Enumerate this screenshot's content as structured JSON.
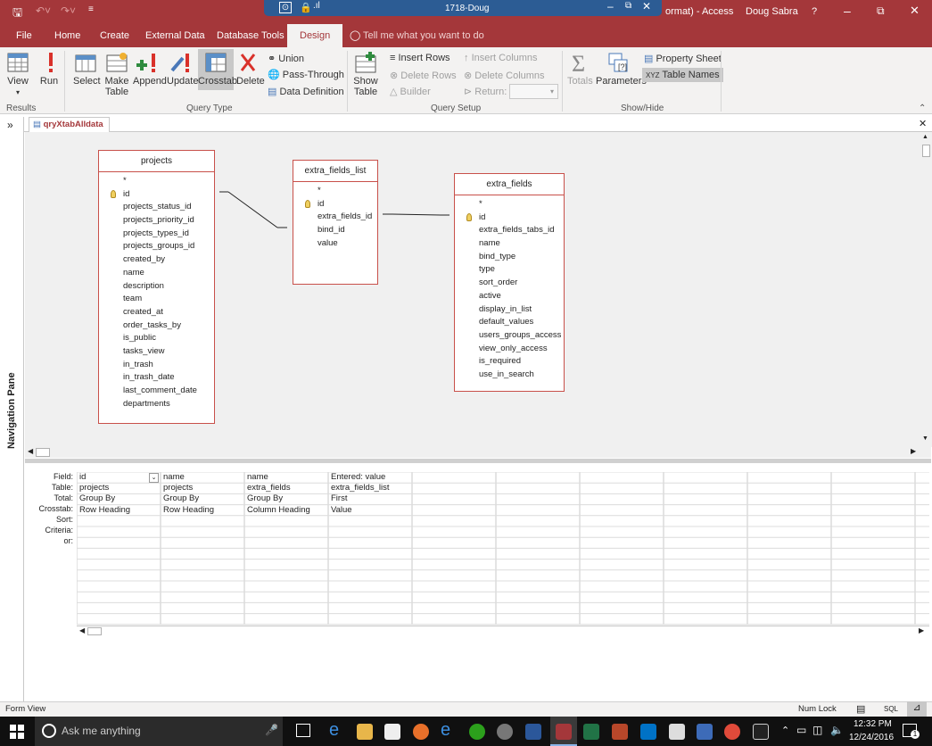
{
  "titlebar": {
    "remote_title": "1718-Doug",
    "app_title_fragment": "ormat) - Access",
    "user": "Doug Sabra",
    "help": "?",
    "quick_access": [
      "save",
      "undo",
      "redo",
      "customize"
    ]
  },
  "ribbon_tabs": [
    "File",
    "Home",
    "Create",
    "External Data",
    "Database Tools",
    "Design"
  ],
  "active_tab": "Design",
  "tell_me": "Tell me what you want to do",
  "ribbon": {
    "results": {
      "label": "Results",
      "view": "View",
      "run": "Run"
    },
    "query_type": {
      "label": "Query Type",
      "select": "Select",
      "make_table": "Make Table",
      "append": "Append",
      "update": "Update",
      "crosstab": "Crosstab",
      "delete": "Delete",
      "union": "Union",
      "pass_through": "Pass-Through",
      "data_definition": "Data Definition"
    },
    "query_setup": {
      "label": "Query Setup",
      "show_table": "Show Table",
      "insert_rows": "Insert Rows",
      "delete_rows": "Delete Rows",
      "builder": "Builder",
      "insert_columns": "Insert Columns",
      "delete_columns": "Delete Columns",
      "return": "Return:"
    },
    "show_hide": {
      "label": "Show/Hide",
      "totals": "Totals",
      "parameters": "Parameters",
      "property_sheet": "Property Sheet",
      "table_names": "Table Names"
    }
  },
  "nav_pane": {
    "label": "Navigation Pane",
    "toggle": "»"
  },
  "document_tab": "qryXtabAlldata",
  "tables": {
    "projects": {
      "name": "projects",
      "fields": [
        "*",
        "id",
        "projects_status_id",
        "projects_priority_id",
        "projects_types_id",
        "projects_groups_id",
        "created_by",
        "name",
        "description",
        "team",
        "created_at",
        "order_tasks_by",
        "is_public",
        "tasks_view",
        "in_trash",
        "in_trash_date",
        "last_comment_date",
        "departments"
      ]
    },
    "extra_fields_list": {
      "name": "extra_fields_list",
      "fields": [
        "*",
        "id",
        "extra_fields_id",
        "bind_id",
        "value"
      ]
    },
    "extra_fields": {
      "name": "extra_fields",
      "fields": [
        "*",
        "id",
        "extra_fields_tabs_id",
        "name",
        "bind_type",
        "type",
        "sort_order",
        "active",
        "display_in_list",
        "default_values",
        "users_groups_access",
        "view_only_access",
        "is_required",
        "use_in_search"
      ]
    }
  },
  "grid": {
    "row_labels": [
      "Field:",
      "Table:",
      "Total:",
      "Crosstab:",
      "Sort:",
      "Criteria:",
      "or:"
    ],
    "columns": [
      {
        "field": "id",
        "table": "projects",
        "total": "Group By",
        "crosstab": "Row Heading"
      },
      {
        "field": "name",
        "table": "projects",
        "total": "Group By",
        "crosstab": "Row Heading"
      },
      {
        "field": "name",
        "table": "extra_fields",
        "total": "Group By",
        "crosstab": "Column Heading"
      },
      {
        "field": "Entered: value",
        "table": "extra_fields_list",
        "total": "First",
        "crosstab": "Value"
      }
    ]
  },
  "statusbar": {
    "view": "Form View",
    "num_lock": "Num Lock",
    "sql": "SQL"
  },
  "taskbar": {
    "search_placeholder": "Ask me anything",
    "time": "12:32 PM",
    "date": "12/24/2016",
    "notifications": "1"
  }
}
